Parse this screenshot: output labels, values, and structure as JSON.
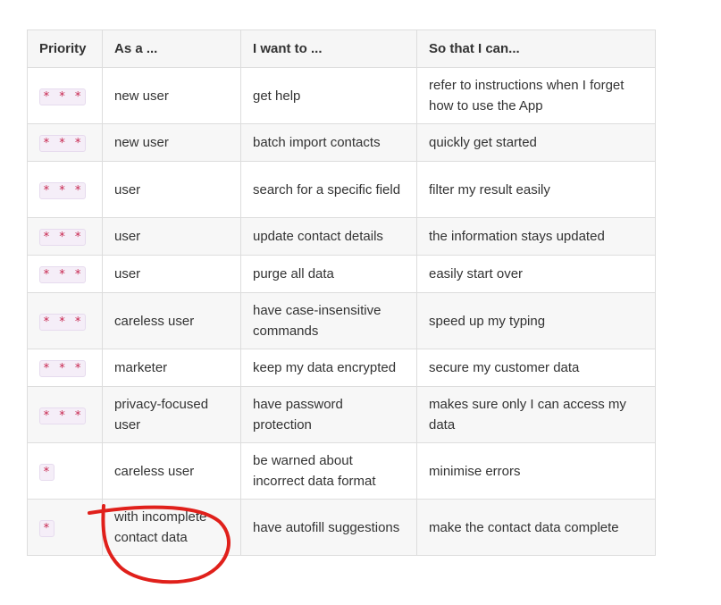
{
  "table": {
    "headers": [
      "Priority",
      "As a ...",
      "I want to ...",
      "So that I can..."
    ],
    "rows": [
      {
        "priority": "* * *",
        "as_a": "new user",
        "want": "get help",
        "so_that": "refer to instructions when I forget how to use the App"
      },
      {
        "priority": "* * *",
        "as_a": "new user",
        "want": "batch import contacts",
        "so_that": "quickly get started"
      },
      {
        "priority": "* * *",
        "as_a": "user",
        "want": "search for a specific field",
        "so_that": "filter my result easily"
      },
      {
        "priority": "* * *",
        "as_a": "user",
        "want": "update contact details",
        "so_that": "the information stays updated"
      },
      {
        "priority": "* * *",
        "as_a": "user",
        "want": "purge all data",
        "so_that": "easily start over"
      },
      {
        "priority": "* * *",
        "as_a": "careless user",
        "want": "have case-insensitive commands",
        "so_that": "speed up my typing"
      },
      {
        "priority": "* * *",
        "as_a": "marketer",
        "want": "keep my data encrypted",
        "so_that": "secure my customer data"
      },
      {
        "priority": "* * *",
        "as_a": "privacy-focused user",
        "want": "have password protection",
        "so_that": "makes sure only I can access my data"
      },
      {
        "priority": "*",
        "as_a": "careless user",
        "want": "be warned about incorrect data format",
        "so_that": "minimise errors"
      },
      {
        "priority": "*",
        "as_a": "with incomplete contact data",
        "want": "have autofill suggestions",
        "so_that": "make the contact data complete"
      }
    ]
  },
  "annotation": {
    "color": "#e0201b"
  }
}
